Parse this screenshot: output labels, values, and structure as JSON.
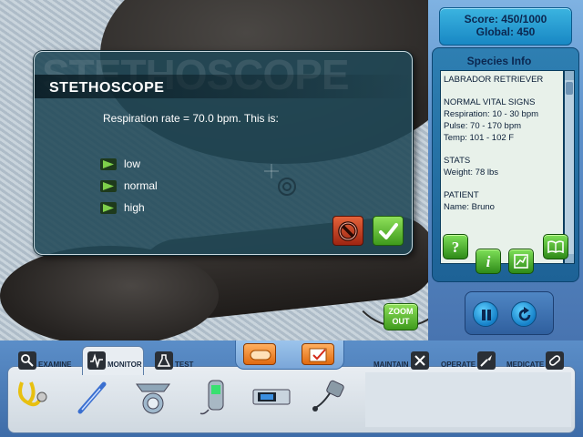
{
  "scene": {
    "zoom_out_label_1": "ZOOM",
    "zoom_out_label_2": "OUT"
  },
  "dialog": {
    "ghost_title": "STETHOSCOPE",
    "title": "STETHOSCOPE",
    "question": "Respiration rate = 70.0 bpm. This is:",
    "options": [
      "low",
      "normal",
      "high"
    ],
    "cancel_icon": "no-sign-icon",
    "ok_icon": "checkmark-icon"
  },
  "score": {
    "score": "Score: 450/1000",
    "global": "Global: 450"
  },
  "species_info": {
    "header": "Species Info",
    "lines": [
      "LABRADOR RETRIEVER",
      "",
      "NORMAL VITAL SIGNS",
      "Respiration: 10 - 30 bpm",
      "Pulse: 70 - 170 bpm",
      "Temp: 101 - 102 F",
      "",
      "STATS",
      "Weight: 78 lbs",
      "",
      "PATIENT",
      "Name: Bruno"
    ]
  },
  "side_buttons": [
    "help-icon",
    "info-icon",
    "chart-icon",
    "book-icon"
  ],
  "playback": [
    "pause-icon",
    "restart-icon"
  ],
  "toolbar": {
    "tabs": {
      "examine": "EXAMINE",
      "monitor": "MONITOR",
      "test": "TEST",
      "maintain": "MAINTAIN",
      "operate": "OPERATE",
      "medicate": "MEDICATE"
    },
    "tools": [
      "stethoscope-icon",
      "thermometer-icon",
      "scale-icon",
      "pulse-oximeter-icon",
      "blood-pressure-monitor-icon",
      "doppler-probe-icon"
    ]
  },
  "colors": {
    "accent_green": "#3f9a1c",
    "panel_blue": "#1d6296",
    "dialog_teal": "#204856",
    "cancel_red": "#9e2512"
  }
}
